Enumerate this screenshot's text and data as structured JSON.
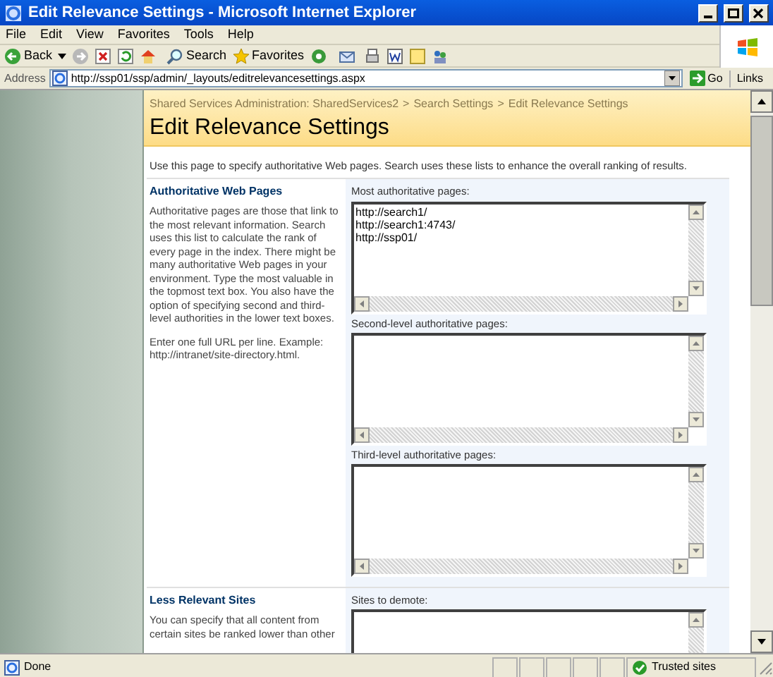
{
  "window": {
    "title": "Edit Relevance Settings - Microsoft Internet Explorer"
  },
  "menu": [
    "File",
    "Edit",
    "View",
    "Favorites",
    "Tools",
    "Help"
  ],
  "toolbar": {
    "back": "Back",
    "search": "Search",
    "favorites": "Favorites"
  },
  "address": {
    "label": "Address",
    "value": "http://ssp01/ssp/admin/_layouts/editrelevancesettings.aspx",
    "go": "Go",
    "links": "Links"
  },
  "breadcrumb": [
    "Shared Services Administration: SharedServices2",
    "Search Settings",
    "Edit Relevance Settings"
  ],
  "breadcrumb_separator": ">",
  "page_title": "Edit Relevance Settings",
  "intro": "Use this page to specify authoritative Web pages. Search uses these lists to enhance the overall ranking of results.",
  "sections": [
    {
      "heading": "Authoritative Web Pages",
      "paragraphs": [
        "Authoritative pages are those that link to the most relevant information. Search uses this list to calculate the rank of every page in the index. There might be many authoritative Web pages in your environment. Type the most valuable in the topmost text box. You also have the option of specifying second and third-level authorities in the lower text boxes.",
        "Enter one full URL per line. Example: http://intranet/site-directory.html."
      ],
      "fields": [
        {
          "label": "Most authoritative pages:",
          "value": [
            "http://search1/",
            "http://search1:4743/",
            "http://ssp01/"
          ]
        },
        {
          "label": "Second-level authoritative pages:"
        },
        {
          "label": "Third-level authoritative pages:"
        }
      ]
    },
    {
      "heading": "Less Relevant Sites",
      "paragraphs": [
        "You can specify that all content from certain sites be ranked lower than other"
      ],
      "fields": [
        {
          "label": "Sites to demote:"
        }
      ]
    }
  ],
  "status_bar": {
    "text": "Done",
    "zone": "Trusted sites"
  }
}
